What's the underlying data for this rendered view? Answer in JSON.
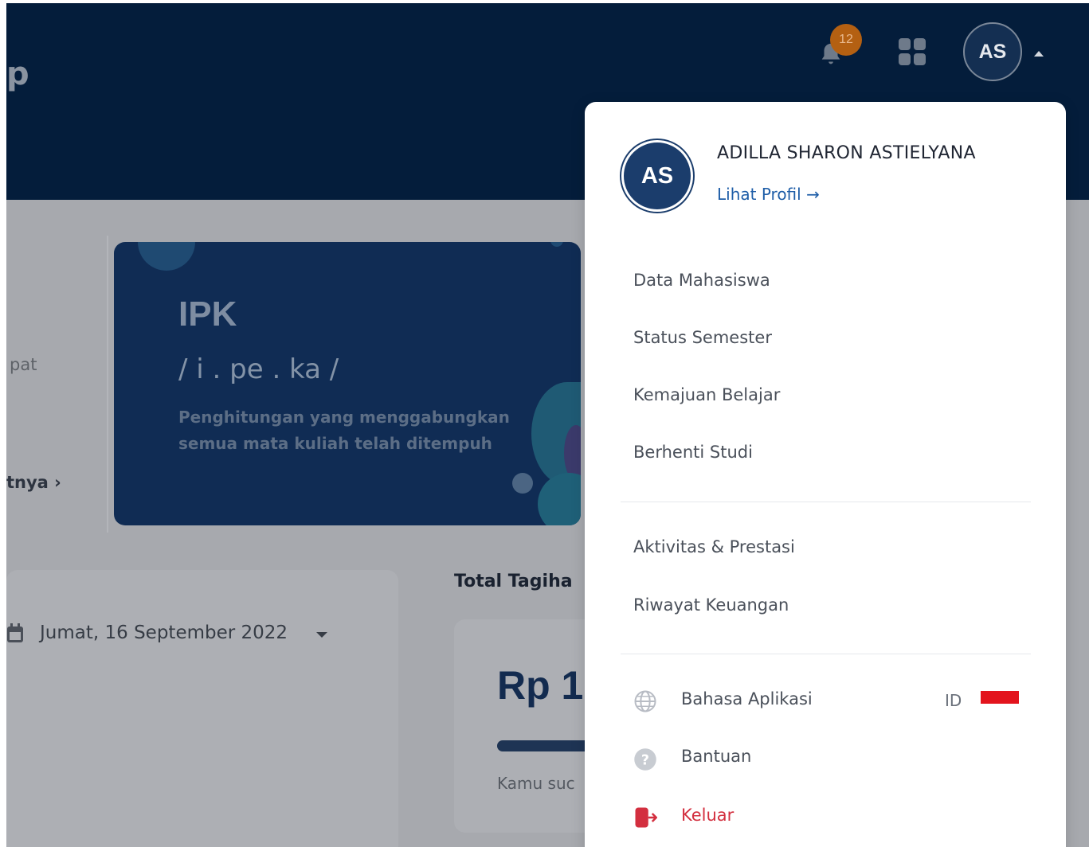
{
  "header": {
    "brand_fragment": "p",
    "notification_count": "12",
    "avatar_initials": "AS"
  },
  "left_panel": {
    "text_top": "pat",
    "link_bottom": "tnya ›"
  },
  "ipk_card": {
    "title": "IPK",
    "phonetic": "/ i . pe . ka /",
    "description": "Penghitungan yang menggabungkan semua mata kuliah telah ditempuh"
  },
  "schedule": {
    "date": "Jumat, 16 September 2022"
  },
  "tagihan": {
    "title": "Total Tagiha",
    "amount": "Rp 1.",
    "note": "Kamu suc"
  },
  "dropdown": {
    "avatar_initials": "AS",
    "name": "ADILLA SHARON ASTIELYANA",
    "profile_link": "Lihat Profil →",
    "menu_group_1": [
      "Data Mahasiswa",
      "Status Semester",
      "Kemajuan Belajar",
      "Berhenti Studi"
    ],
    "menu_group_2": [
      "Aktivitas & Prestasi",
      "Riwayat Keuangan"
    ],
    "language_label": "Bahasa Aplikasi",
    "language_code": "ID",
    "help_label": "Bantuan",
    "logout_label": "Keluar"
  },
  "colors": {
    "header_bg": "#041d3b",
    "accent_blue": "#1b3d6c",
    "link_blue": "#1f5ea8",
    "logout_red": "#d32f3f",
    "flag_red": "#e3141d"
  }
}
